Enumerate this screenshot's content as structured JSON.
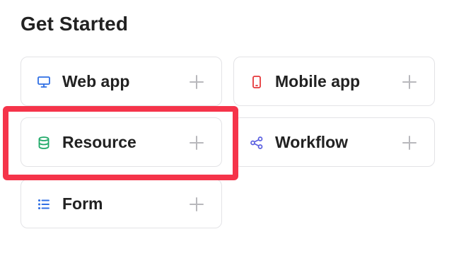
{
  "section_title": "Get Started",
  "cards": [
    {
      "id": "web-app",
      "label": "Web app",
      "icon": "monitor-icon",
      "icon_color": "#2f6fe4"
    },
    {
      "id": "mobile-app",
      "label": "Mobile app",
      "icon": "mobile-phone-icon",
      "icon_color": "#e5383b"
    },
    {
      "id": "resource",
      "label": "Resource",
      "icon": "database-icon",
      "icon_color": "#1fa968"
    },
    {
      "id": "workflow",
      "label": "Workflow",
      "icon": "share-nodes-icon",
      "icon_color": "#5a5fe0"
    },
    {
      "id": "form",
      "label": "Form",
      "icon": "list-icon",
      "icon_color": "#2f6fe4"
    }
  ],
  "colors": {
    "highlight": "#f5344a",
    "card_border": "#e3e3e6",
    "plus": "#b8b8bc"
  }
}
